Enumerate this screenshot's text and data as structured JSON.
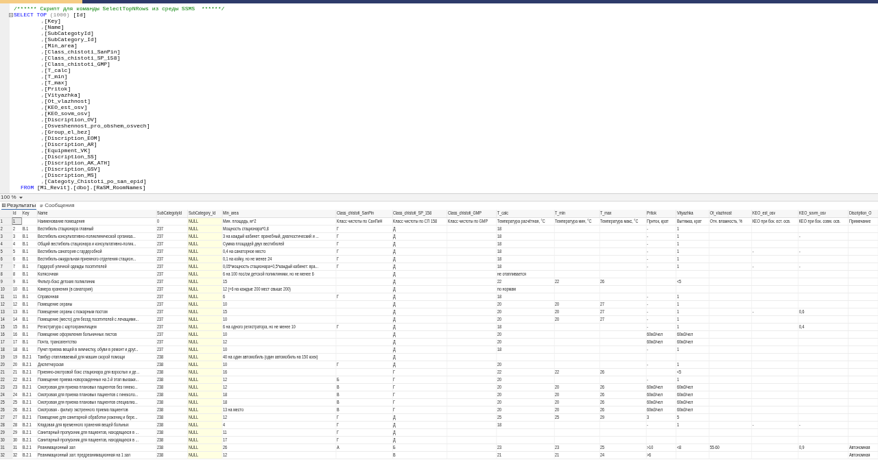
{
  "editor": {
    "lines": [
      {
        "kind": "comment",
        "parts": [
          {
            "t": "/****** Скрипт для команды SelectTopNRows из среды SSMS  ******/",
            "kind": "comment"
          }
        ]
      },
      {
        "kind": "select",
        "parts": [
          {
            "t": "SELECT TOP ",
            "kind": "keyword"
          },
          {
            "t": "(1000)",
            "kind": "grey"
          },
          {
            "t": " [Id]",
            "kind": "plain"
          }
        ]
      },
      {
        "kind": "item",
        "parts": [
          {
            "t": ",",
            "kind": "grey"
          },
          {
            "t": "[Key]",
            "kind": "plain"
          }
        ]
      },
      {
        "kind": "item",
        "parts": [
          {
            "t": ",",
            "kind": "grey"
          },
          {
            "t": "[Name]",
            "kind": "plain"
          }
        ]
      },
      {
        "kind": "item",
        "parts": [
          {
            "t": ",",
            "kind": "grey"
          },
          {
            "t": "[SubCategotyId]",
            "kind": "plain"
          }
        ]
      },
      {
        "kind": "item",
        "parts": [
          {
            "t": ",",
            "kind": "grey"
          },
          {
            "t": "[SubCategory_Id]",
            "kind": "plain"
          }
        ]
      },
      {
        "kind": "item",
        "parts": [
          {
            "t": ",",
            "kind": "grey"
          },
          {
            "t": "[Min_area]",
            "kind": "plain"
          }
        ]
      },
      {
        "kind": "item",
        "parts": [
          {
            "t": ",",
            "kind": "grey"
          },
          {
            "t": "[Class_chistoti_SanPin]",
            "kind": "plain"
          }
        ]
      },
      {
        "kind": "item",
        "parts": [
          {
            "t": ",",
            "kind": "grey"
          },
          {
            "t": "[Class_chistoti_SP_158]",
            "kind": "plain"
          }
        ]
      },
      {
        "kind": "item",
        "parts": [
          {
            "t": ",",
            "kind": "grey"
          },
          {
            "t": "[Class_chistoti_GMP]",
            "kind": "plain"
          }
        ]
      },
      {
        "kind": "item",
        "parts": [
          {
            "t": ",",
            "kind": "grey"
          },
          {
            "t": "[T_calc]",
            "kind": "plain"
          }
        ]
      },
      {
        "kind": "item",
        "parts": [
          {
            "t": ",",
            "kind": "grey"
          },
          {
            "t": "[T_min]",
            "kind": "plain"
          }
        ]
      },
      {
        "kind": "item",
        "parts": [
          {
            "t": ",",
            "kind": "grey"
          },
          {
            "t": "[T_max]",
            "kind": "plain"
          }
        ]
      },
      {
        "kind": "item",
        "parts": [
          {
            "t": ",",
            "kind": "grey"
          },
          {
            "t": "[Pritok]",
            "kind": "plain"
          }
        ]
      },
      {
        "kind": "item",
        "parts": [
          {
            "t": ",",
            "kind": "grey"
          },
          {
            "t": "[Vityazhka]",
            "kind": "plain"
          }
        ]
      },
      {
        "kind": "item",
        "parts": [
          {
            "t": ",",
            "kind": "grey"
          },
          {
            "t": "[Ot_vlazhnost]",
            "kind": "plain"
          }
        ]
      },
      {
        "kind": "item",
        "parts": [
          {
            "t": ",",
            "kind": "grey"
          },
          {
            "t": "[KEO_est_osv]",
            "kind": "plain"
          }
        ]
      },
      {
        "kind": "item",
        "parts": [
          {
            "t": ",",
            "kind": "grey"
          },
          {
            "t": "[KEO_sovm_osv]",
            "kind": "plain"
          }
        ]
      },
      {
        "kind": "item",
        "parts": [
          {
            "t": ",",
            "kind": "grey"
          },
          {
            "t": "[Discription_OV]",
            "kind": "plain"
          }
        ]
      },
      {
        "kind": "item",
        "parts": [
          {
            "t": ",",
            "kind": "grey"
          },
          {
            "t": "[Osveshennost_pro_obshem_osvech]",
            "kind": "plain"
          }
        ]
      },
      {
        "kind": "item",
        "parts": [
          {
            "t": ",",
            "kind": "grey"
          },
          {
            "t": "[Group_el_bez]",
            "kind": "plain"
          }
        ]
      },
      {
        "kind": "item",
        "parts": [
          {
            "t": ",",
            "kind": "grey"
          },
          {
            "t": "[Discription_EOM]",
            "kind": "plain"
          }
        ]
      },
      {
        "kind": "item",
        "parts": [
          {
            "t": ",",
            "kind": "grey"
          },
          {
            "t": "[Discription_AR]",
            "kind": "plain"
          }
        ]
      },
      {
        "kind": "item",
        "parts": [
          {
            "t": ",",
            "kind": "grey"
          },
          {
            "t": "[Equipment_VK]",
            "kind": "plain"
          }
        ]
      },
      {
        "kind": "item",
        "parts": [
          {
            "t": ",",
            "kind": "grey"
          },
          {
            "t": "[Discription_SS]",
            "kind": "plain"
          }
        ]
      },
      {
        "kind": "item",
        "parts": [
          {
            "t": ",",
            "kind": "grey"
          },
          {
            "t": "[Discription_AK_ATH]",
            "kind": "plain"
          }
        ]
      },
      {
        "kind": "item",
        "parts": [
          {
            "t": ",",
            "kind": "grey"
          },
          {
            "t": "[Discription_GSV]",
            "kind": "plain"
          }
        ]
      },
      {
        "kind": "item",
        "parts": [
          {
            "t": ",",
            "kind": "grey"
          },
          {
            "t": "[Discription_MS]",
            "kind": "plain"
          }
        ]
      },
      {
        "kind": "item",
        "parts": [
          {
            "t": ",",
            "kind": "grey"
          },
          {
            "t": "[Categoty_Chistoti_po_san_epid]",
            "kind": "plain"
          }
        ]
      },
      {
        "kind": "from",
        "parts": [
          {
            "t": "FROM ",
            "kind": "keyword"
          },
          {
            "t": "[M1_Revit].[dbo].[RaSM_RoomNames]",
            "kind": "plain"
          }
        ]
      }
    ]
  },
  "zoom": {
    "value": "100 %"
  },
  "result_tabs": [
    {
      "label": "Результаты",
      "kind": "grid",
      "selected": true
    },
    {
      "label": "Сообщения",
      "kind": "messages",
      "selected": false
    }
  ],
  "table": {
    "columns": [
      "Id",
      "Key",
      "Name",
      "SubCategotyId",
      "SubCategory_Id",
      "Min_area",
      "Class_chistoti_SanPin",
      "Class_chistoti_SP_158",
      "Class_chistoti_GMP",
      "T_calc",
      "T_min",
      "T_max",
      "Pritok",
      "Vityazhka",
      "Ot_vlazhnost",
      "KEO_est_osv",
      "KEO_sovm_osv",
      "Discription_O"
    ],
    "rows": [
      {
        "number": "1",
        "focused": true,
        "cells": [
          "1",
          null,
          "Наименование помещения",
          "0",
          "NULL",
          "Мин. площадь, м^2",
          "Класс чистоты по СанПиН",
          "Класс чистоты по СП 158",
          "Класс чистоты по GMP",
          "Температура расчётная, °С",
          "Температура мин, °С",
          "Температура макс, °С",
          "Приток, крат",
          "Вытяжка, крат",
          "Отн. влажность, %",
          "КЕО при бок. ест. осв.",
          "КЕО при бок. совм. осв.",
          "Примечание"
        ]
      },
      {
        "number": "2",
        "focused": false,
        "cells": [
          "2",
          "В.1",
          "Вестибюль стационара главный",
          "237",
          "NULL",
          "Мощность стационара*0,8",
          "Г",
          "Д",
          null,
          "18",
          null,
          null,
          "-",
          "1",
          null,
          null,
          null,
          null
        ]
      },
      {
        "number": "3",
        "focused": false,
        "cells": [
          "3",
          "В.1",
          "Вестибюль консультативно-поликлинической организа...",
          "237",
          "NULL",
          "3 на каждый кабинет: врачебный, диагностический и ...",
          "Г",
          "Д",
          null,
          "18",
          null,
          null,
          "-",
          "1",
          null,
          null,
          "-",
          null
        ]
      },
      {
        "number": "4",
        "focused": false,
        "cells": [
          "4",
          "В.1",
          "Общий вестибюль стационара и консультативно-полик...",
          "237",
          "NULL",
          "Сумма площадей двух вестибюлей",
          "Г",
          "Д",
          null,
          "18",
          null,
          null,
          "-",
          "1",
          null,
          null,
          null,
          null
        ]
      },
      {
        "number": "5",
        "focused": false,
        "cells": [
          "5",
          "В.1",
          "Вестибюль санатория с гардеробной",
          "237",
          "NULL",
          "0,4 на санаторное место",
          "Г",
          "Д",
          null,
          "18",
          null,
          null,
          "-",
          "1",
          null,
          "-",
          "-",
          null
        ]
      },
      {
        "number": "6",
        "focused": false,
        "cells": [
          "6",
          "В.1",
          "Вестибюль-ожидальная приемного отделения стацион...",
          "237",
          "NULL",
          "0,1 на койку, но не менее 24",
          "Г",
          "Д",
          null,
          "18",
          null,
          null,
          "-",
          "1",
          null,
          null,
          null,
          null
        ]
      },
      {
        "number": "7",
        "focused": false,
        "cells": [
          "7",
          "В.1",
          "Гардероб уличной одежды посетителей",
          "237",
          "NULL",
          "0,05*мощность стационара+0,5*каждый кабинет: вра...",
          "Г",
          "Д",
          null,
          "18",
          null,
          null,
          "-",
          "1",
          null,
          "-",
          "-",
          null
        ]
      },
      {
        "number": "8",
        "focused": false,
        "cells": [
          "8",
          "В.1",
          "Колясочная",
          "237",
          "NULL",
          "6 на 100 пос/см детской поликлиники, но не менее 6",
          null,
          "Д",
          null,
          "не отапливается",
          null,
          null,
          null,
          null,
          null,
          null,
          null,
          null
        ]
      },
      {
        "number": "9",
        "focused": false,
        "cells": [
          "9",
          "В.1",
          "Фильтр-бокс детоких поликлиник",
          "237",
          "NULL",
          "15",
          null,
          "Д",
          null,
          "22",
          "22",
          "26",
          null,
          "<5",
          null,
          null,
          null,
          null
        ]
      },
      {
        "number": "10",
        "focused": false,
        "cells": [
          "10",
          "В.1",
          "Камера хранения (в санатория)",
          "237",
          "NULL",
          "12 (+6 на каждые 200 мест свыше 200)",
          null,
          "Д",
          null,
          "по нормам",
          null,
          null,
          null,
          null,
          null,
          null,
          null,
          null
        ]
      },
      {
        "number": "11",
        "focused": false,
        "cells": [
          "11",
          "В.1",
          "Справочная",
          "237",
          "NULL",
          "6",
          "Г",
          "Д",
          null,
          "18",
          null,
          null,
          "-",
          "1",
          null,
          null,
          null,
          null
        ]
      },
      {
        "number": "12",
        "focused": false,
        "cells": [
          "12",
          "В.1",
          "Помещение охраны",
          "237",
          "NULL",
          "10",
          null,
          "Д",
          null,
          "20",
          "20",
          "27",
          "-",
          "1",
          null,
          null,
          null,
          null
        ]
      },
      {
        "number": "13",
        "focused": false,
        "cells": [
          "13",
          "В.1",
          "Помещение охраны с пожарным постом",
          "237",
          "NULL",
          "15",
          null,
          "Д",
          null,
          "20",
          "20",
          "27",
          "-",
          "1",
          null,
          "-",
          "0,6",
          null
        ]
      },
      {
        "number": "14",
        "focused": false,
        "cells": [
          "14",
          "В.1",
          "Помещение (место) для бесед посетителей с лечащими...",
          "237",
          "NULL",
          "10",
          null,
          "Д",
          null,
          "20",
          "20",
          "27",
          "-",
          "1",
          null,
          null,
          null,
          null
        ]
      },
      {
        "number": "15",
        "focused": false,
        "cells": [
          "15",
          "В.1",
          "Регистратура с картохранилищем",
          "237",
          "NULL",
          "6 на одного регистратора,  но не менее 10",
          "Г",
          "Д",
          null,
          "18",
          null,
          null,
          "-",
          "1",
          null,
          null,
          "0,4",
          null
        ]
      },
      {
        "number": "16",
        "focused": false,
        "cells": [
          "16",
          "В.1",
          "Помещение оформления больничных листов",
          "237",
          "NULL",
          "10",
          null,
          "Д",
          null,
          "20",
          null,
          null,
          "60м3/чел",
          "60м3/чел",
          null,
          null,
          null,
          null
        ]
      },
      {
        "number": "17",
        "focused": false,
        "cells": [
          "17",
          "В.1",
          "Почта, трансагентство",
          "237",
          "NULL",
          "12",
          null,
          "Д",
          null,
          "20",
          null,
          null,
          "60м3/чел",
          "60м3/чел",
          null,
          null,
          null,
          null
        ]
      },
      {
        "number": "18",
        "focused": false,
        "cells": [
          "18",
          "В.1",
          "Пункт приема вещей в химчистку, обуви в ремонт и друг...",
          "237",
          "NULL",
          "10",
          null,
          "Д",
          null,
          "18",
          null,
          null,
          "-",
          "1",
          null,
          null,
          null,
          null
        ]
      },
      {
        "number": "19",
        "focused": false,
        "cells": [
          "19",
          "В.2.1",
          "Тамбур отапливаемый для машин скорой помощи",
          "238",
          "NULL",
          "40 на один автомобиль  (один автомобиль на 150 коек)",
          null,
          "Д",
          null,
          null,
          null,
          null,
          null,
          null,
          null,
          null,
          null,
          null
        ]
      },
      {
        "number": "20",
        "focused": false,
        "cells": [
          "20",
          "В.2.1",
          "Диспетчерская",
          "238",
          "NULL",
          "10",
          "Г",
          "Д",
          null,
          "20",
          null,
          null,
          "-",
          "1",
          null,
          null,
          null,
          null
        ]
      },
      {
        "number": "21",
        "focused": false,
        "cells": [
          "21",
          "В.2.1",
          "Приемно-смотровой бокс стационара для взрослых и де...",
          "238",
          "NULL",
          "16",
          null,
          "Г",
          null,
          "22",
          "22",
          "26",
          null,
          "<5",
          null,
          null,
          null,
          null
        ]
      },
      {
        "number": "22",
        "focused": false,
        "cells": [
          "22",
          "В.2.1",
          "Помещение приема новорожденных на 2-й этап выхажи...",
          "238",
          "NULL",
          "12",
          "Б",
          "Г",
          null,
          "20",
          null,
          null,
          "-",
          "1",
          null,
          null,
          null,
          null
        ]
      },
      {
        "number": "23",
        "focused": false,
        "cells": [
          "23",
          "В.2.1",
          "Смотровая для приема плановых пациентов без гинеко...",
          "238",
          "NULL",
          "12",
          "В",
          "Г",
          null,
          "20",
          "20",
          "26",
          "60м3/чел",
          "60м3/чел",
          null,
          null,
          null,
          null
        ]
      },
      {
        "number": "24",
        "focused": false,
        "cells": [
          "24",
          "В.2.1",
          "Смотровая для приема плановых пациентов с гинеколо...",
          "238",
          "NULL",
          "18",
          "В",
          "Г",
          null,
          "20",
          "20",
          "26",
          "60м3/чел",
          "60м3/чел",
          null,
          null,
          null,
          null
        ]
      },
      {
        "number": "25",
        "focused": false,
        "cells": [
          "25",
          "В.2.1",
          "Смотровая для приема плановых пациентов специализ...",
          "238",
          "NULL",
          "18",
          "В",
          "Г",
          null,
          "20",
          "20",
          "26",
          "60м3/чел",
          "60м3/чел",
          null,
          null,
          null,
          null
        ]
      },
      {
        "number": "26",
        "focused": false,
        "cells": [
          "26",
          "В.2.1",
          "Смотровая - фильтр экстренного приема пациентов",
          "238",
          "NULL",
          "13 на место",
          "В",
          "Г",
          null,
          "20",
          "20",
          "26",
          "60м3/чел",
          "60м3/чел",
          null,
          null,
          null,
          null
        ]
      },
      {
        "number": "27",
        "focused": false,
        "cells": [
          "27",
          "В.2.1",
          "Помещение для санитарной обработки рожениц и бере...",
          "238",
          "NULL",
          "12",
          "Г",
          "Д",
          null,
          "25",
          "25",
          "29",
          "3",
          "5",
          null,
          null,
          null,
          null
        ]
      },
      {
        "number": "28",
        "focused": false,
        "cells": [
          "28",
          "В.2.1",
          "Кладовая для временного хранения вещей больных",
          "238",
          "NULL",
          "4",
          "Г",
          "Д",
          null,
          "18",
          null,
          null,
          "-",
          "1",
          null,
          "-",
          "-",
          null
        ]
      },
      {
        "number": "29",
        "focused": false,
        "cells": [
          "29",
          "В.2.1",
          "Санитарный пропускник для пациентов, находящихся в ...",
          "238",
          "NULL",
          "11",
          "Г",
          "Д",
          null,
          null,
          null,
          null,
          null,
          null,
          null,
          null,
          null,
          null
        ]
      },
      {
        "number": "30",
        "focused": false,
        "cells": [
          "30",
          "В.2.1",
          "Санитарный пропускник для пациентов, находящихся в ...",
          "238",
          "NULL",
          "17",
          "Г",
          "Д",
          null,
          null,
          null,
          null,
          null,
          null,
          null,
          null,
          null,
          null
        ]
      },
      {
        "number": "31",
        "focused": false,
        "cells": [
          "31",
          "В.2.1",
          "Реанимационный зал",
          "238",
          "NULL",
          "26",
          "А",
          "Б",
          null,
          "23",
          "23",
          "25",
          ">10",
          "<8",
          "55-60",
          null,
          "0,9",
          "Автономная"
        ]
      },
      {
        "number": "32",
        "focused": false,
        "cells": [
          "32",
          "В.2.1",
          "Реанимационный зал: предреанимационная на 1 зал",
          "238",
          "NULL",
          "12",
          null,
          "В",
          null,
          "21",
          "21",
          "24",
          ">6",
          null,
          null,
          null,
          null,
          "Автономная"
        ]
      }
    ]
  }
}
